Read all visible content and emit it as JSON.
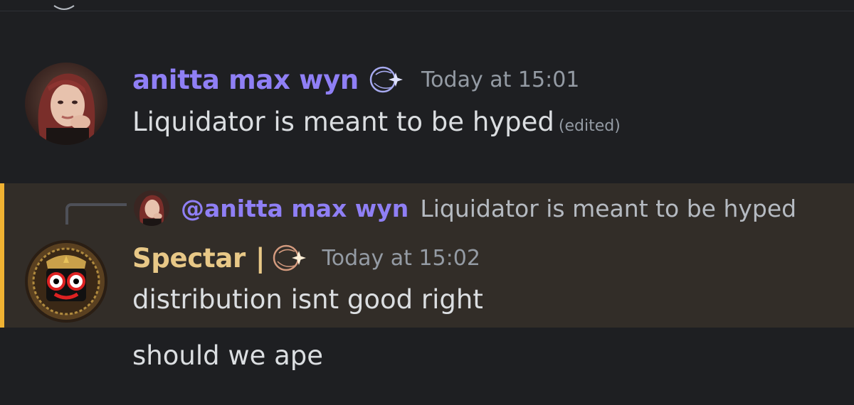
{
  "messages": [
    {
      "author": "anitta max wyn",
      "role_icon": "crescent-sparkle-icon",
      "timestamp": "Today at 15:01",
      "content": "Liquidator is meant to be hyped",
      "edited_label": "(edited)"
    },
    {
      "reply": {
        "author": "@anitta max wyn",
        "text": "Liquidator is meant to be hyped"
      },
      "author": "Spectar",
      "author_separator": "|",
      "role_icon": "crescent-sparkle-icon",
      "timestamp": "Today at 15:02",
      "content": "distribution isnt good right",
      "highlighted": true
    },
    {
      "content": "should we ape"
    }
  ],
  "colors": {
    "background": "#1e1f22",
    "mention_highlight_bg": "#322d28",
    "mention_highlight_bar": "#f0b232",
    "author_purple": "#8f7ff5",
    "author_gold": "#e8c887",
    "timestamp": "#949ba4",
    "message_text": "#dbdee1"
  }
}
